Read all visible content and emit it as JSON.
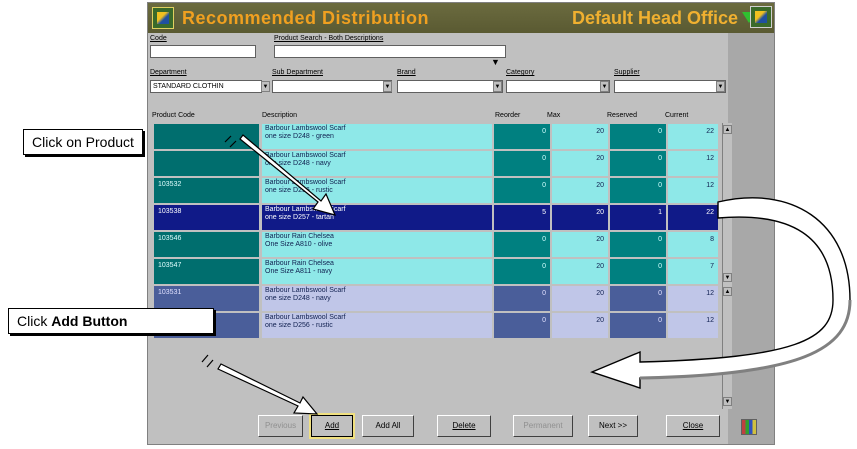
{
  "window": {
    "title": "Recommended Distribution",
    "head_office": "Default Head Office"
  },
  "filters": {
    "code_label": "Code",
    "code_value": "",
    "search_label": "Product Search - Both Descriptions",
    "search_value": "",
    "department_label": "Department",
    "department_value": "STANDARD CLOTHIN",
    "subdepartment_label": "Sub Department",
    "brand_label": "Brand",
    "category_label": "Category",
    "supplier_label": "Supplier"
  },
  "columns": {
    "code": "Product Code",
    "description": "Description",
    "reorder": "Reorder",
    "max": "Max",
    "reserved": "Reserved",
    "current": "Current"
  },
  "rows": [
    {
      "code": "",
      "desc1": "Barbour Lambswool Scarf",
      "desc2": "one size D248 - green",
      "reorder": "0",
      "max": "20",
      "reserved": "0",
      "current": "22"
    },
    {
      "code": "",
      "desc1": "Barbour Lambswool Scarf",
      "desc2": "one size D248 - navy",
      "reorder": "0",
      "max": "20",
      "reserved": "0",
      "current": "12"
    },
    {
      "code": "103532",
      "desc1": "Barbour Lambswool Scarf",
      "desc2": "one size D256 - rustic",
      "reorder": "0",
      "max": "20",
      "reserved": "0",
      "current": "12"
    },
    {
      "code": "103538",
      "desc1": "Barbour Lambswool Scarf",
      "desc2": "one size D257 - tartan",
      "reorder": "5",
      "max": "20",
      "reserved": "1",
      "current": "22"
    },
    {
      "code": "103546",
      "desc1": "Barbour Rain Chelsea",
      "desc2": "One Size A810 - olive",
      "reorder": "0",
      "max": "20",
      "reserved": "0",
      "current": "8"
    },
    {
      "code": "103547",
      "desc1": "Barbour Rain Chelsea",
      "desc2": "One Size A811 - navy",
      "reorder": "0",
      "max": "20",
      "reserved": "0",
      "current": "7"
    }
  ],
  "rows2": [
    {
      "code": "103531",
      "desc1": "Barbour Lambswool Scarf",
      "desc2": "one size D248 - navy",
      "reorder": "0",
      "max": "20",
      "reserved": "0",
      "current": "12"
    },
    {
      "code": "",
      "desc1": "Barbour Lambswool Scarf",
      "desc2": "one size D256 - rustic",
      "reorder": "0",
      "max": "20",
      "reserved": "0",
      "current": "12"
    }
  ],
  "buttons": {
    "previous": "Previous",
    "add": "Add",
    "add_all": "Add All",
    "delete": "Delete",
    "permanent": "Permanent",
    "next": "Next >>",
    "close": "Close"
  },
  "callouts": {
    "product": "Click on Product",
    "add_prefix": "Click ",
    "add_bold": "Add Button"
  },
  "colors": {
    "title_text": "#f0a020",
    "teal_row": "#8ee8e8",
    "selected_row": "#101a88",
    "lavender_row": "#c0c6e8"
  }
}
